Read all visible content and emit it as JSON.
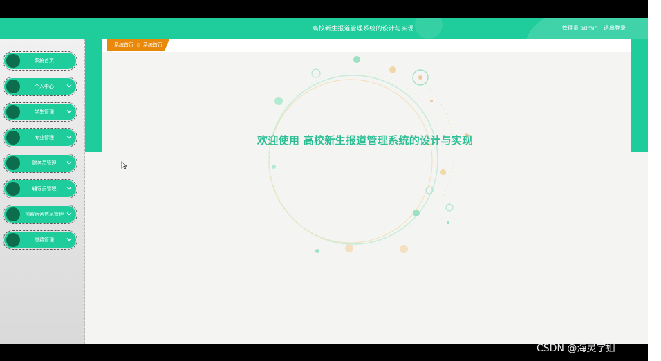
{
  "header": {
    "title": "高校新生报道管理系统的设计与实现",
    "user_label": "管理员 admin",
    "logout_label": "退出登录"
  },
  "breadcrumb": {
    "home": "系统首页",
    "current": "系统首页"
  },
  "sidebar": {
    "items": [
      {
        "label": "系统首页",
        "has_chevron": false
      },
      {
        "label": "个人中心",
        "has_chevron": true
      },
      {
        "label": "学生管理",
        "has_chevron": true
      },
      {
        "label": "专业管理",
        "has_chevron": true
      },
      {
        "label": "财务员管理",
        "has_chevron": true
      },
      {
        "label": "辅导员管理",
        "has_chevron": true
      },
      {
        "label": "预留宿舍信息管理",
        "has_chevron": true
      },
      {
        "label": "缴费管理",
        "has_chevron": true
      }
    ]
  },
  "main": {
    "welcome_text": "欢迎使用 高校新生报道管理系统的设计与实现"
  },
  "watermark": "CSDN @海灵学姐",
  "colors": {
    "primary": "#1fcc9b",
    "sidebar_dot": "#0d6e4e",
    "breadcrumb": "#e8890c",
    "welcome": "#2cbf95"
  }
}
